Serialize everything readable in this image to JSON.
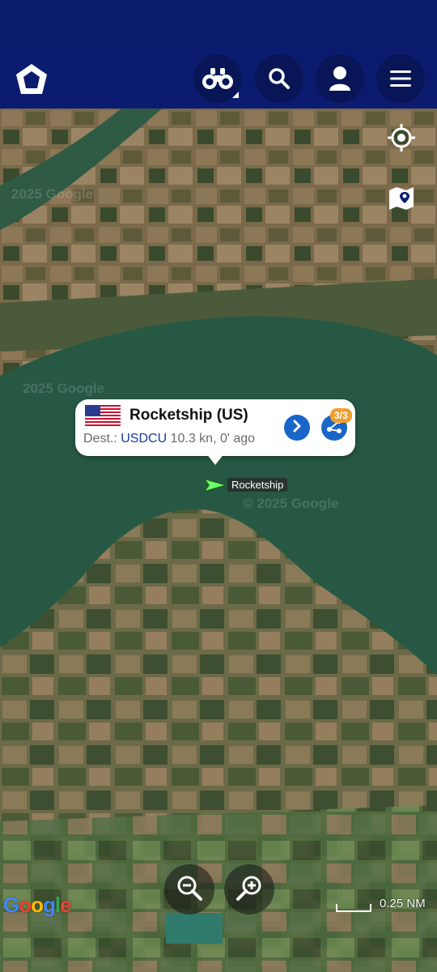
{
  "icons": {
    "logo": "marinetraffic-logo-icon",
    "binoculars": "binoculars-icon",
    "search": "search-icon",
    "account": "account-icon",
    "menu": "menu-icon",
    "locate": "locate-me-icon",
    "map_layers": "map-layers-icon",
    "details": "chevron-right-icon",
    "share": "share-icon",
    "zoom_out": "zoom-out-icon",
    "zoom_in": "zoom-in-icon"
  },
  "colors": {
    "app_bar": "#0b1c70",
    "accent_button": "#1a66c8",
    "badge": "#f0a030",
    "ship_marker": "#6dff6d"
  },
  "vessel_popup": {
    "name": "Rocketship (US)",
    "dest_label": "Dest.:",
    "dest_code": "USDCU",
    "speed_age": "10.3 kn, 0' ago",
    "badge": "3/3"
  },
  "ship_label": "Rocketship",
  "watermarks": [
    "2025 Google",
    "2025 Google",
    "© 2025 Google"
  ],
  "scale": {
    "label": "0.25 NM"
  },
  "google_logo": {
    "letters": [
      "G",
      "o",
      "o",
      "g",
      "l",
      "e"
    ]
  }
}
